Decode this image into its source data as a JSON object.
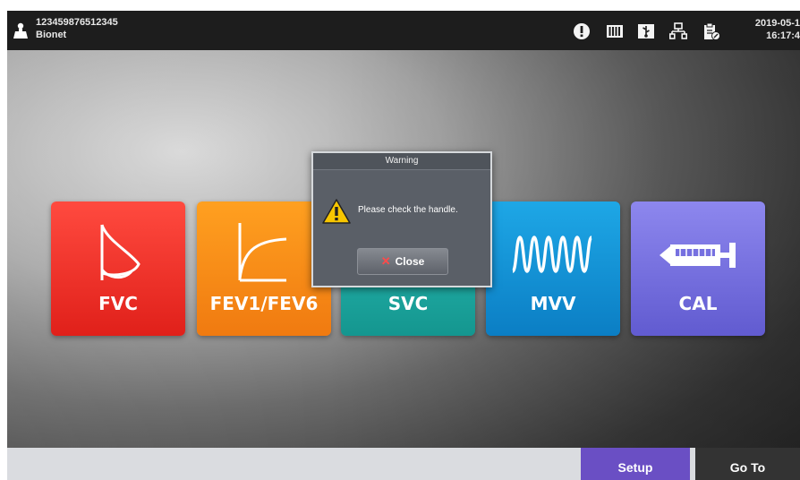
{
  "status_bar": {
    "device_id": "123459876512345",
    "network": "Bionet",
    "date": "2019-05-1",
    "time": "16:17:4",
    "icons": [
      "alert-icon",
      "battery-level-icon",
      "usb-icon",
      "network-icon",
      "clipboard-edit-icon"
    ]
  },
  "tiles": [
    {
      "label": "FVC",
      "icon": "fvc-loop-icon",
      "color": "#e83228"
    },
    {
      "label": "FEV1/FEV6",
      "icon": "fev-curve-icon",
      "color": "#f58a14"
    },
    {
      "label": "SVC",
      "icon": "svc-icon",
      "color": "#1faaa3"
    },
    {
      "label": "MVV",
      "icon": "mvv-wave-icon",
      "color": "#1592d6"
    },
    {
      "label": "CAL",
      "icon": "calibration-syringe-icon",
      "color": "#7670e0"
    }
  ],
  "dialog": {
    "title": "Warning",
    "message": "Please check the handle.",
    "close_label": "Close"
  },
  "bottom_bar": {
    "setup_label": "Setup",
    "goto_label": "Go To",
    "setup_color": "#6a4fc4"
  }
}
